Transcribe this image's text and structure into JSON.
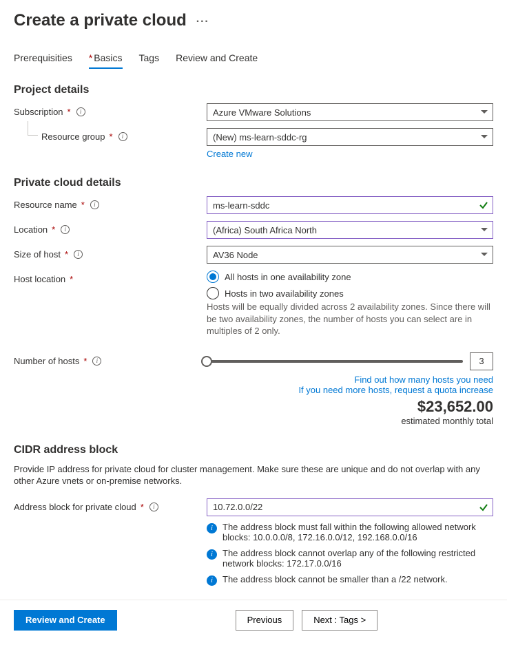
{
  "header": {
    "title": "Create a private cloud"
  },
  "tabs": {
    "prereq": "Prerequisities",
    "basics": "Basics",
    "tags": "Tags",
    "review": "Review and Create"
  },
  "project": {
    "section": "Project details",
    "subscription_label": "Subscription",
    "subscription_value": "Azure VMware Solutions",
    "rg_label": "Resource group",
    "rg_value": "(New) ms-learn-sddc-rg",
    "create_new": "Create new"
  },
  "cloud": {
    "section": "Private cloud details",
    "resource_label": "Resource name",
    "resource_value": "ms-learn-sddc",
    "location_label": "Location",
    "location_value": "(Africa) South Africa North",
    "size_label": "Size of host",
    "size_value": "AV36 Node",
    "hostloc_label": "Host location",
    "radio1": "All hosts in one availability zone",
    "radio2": "Hosts in two availability zones",
    "radio2_help": "Hosts will be equally divided across 2 availability zones. Since there will be two availability zones, the number of hosts you can select are in multiples of 2 only.",
    "numhosts_label": "Number of hosts",
    "numhosts_value": "3",
    "link1": "Find out how many hosts you need",
    "link2": "If you need more hosts, request a quota increase",
    "price": "$23,652.00",
    "price_sub": "estimated monthly total"
  },
  "cidr": {
    "section": "CIDR address block",
    "desc": "Provide IP address for private cloud for cluster management. Make sure these are unique and do not overlap with any other Azure vnets or on-premise networks.",
    "addr_label": "Address block for private cloud",
    "addr_value": "10.72.0.0/22",
    "b1": "The address block must fall within the following allowed network blocks: 10.0.0.0/8, 172.16.0.0/12, 192.168.0.0/16",
    "b2": "The address block cannot overlap any of the following restricted network blocks: 172.17.0.0/16",
    "b3": "The address block cannot be smaller than a /22 network."
  },
  "footer": {
    "review": "Review and Create",
    "previous": "Previous",
    "next": "Next : Tags >"
  }
}
